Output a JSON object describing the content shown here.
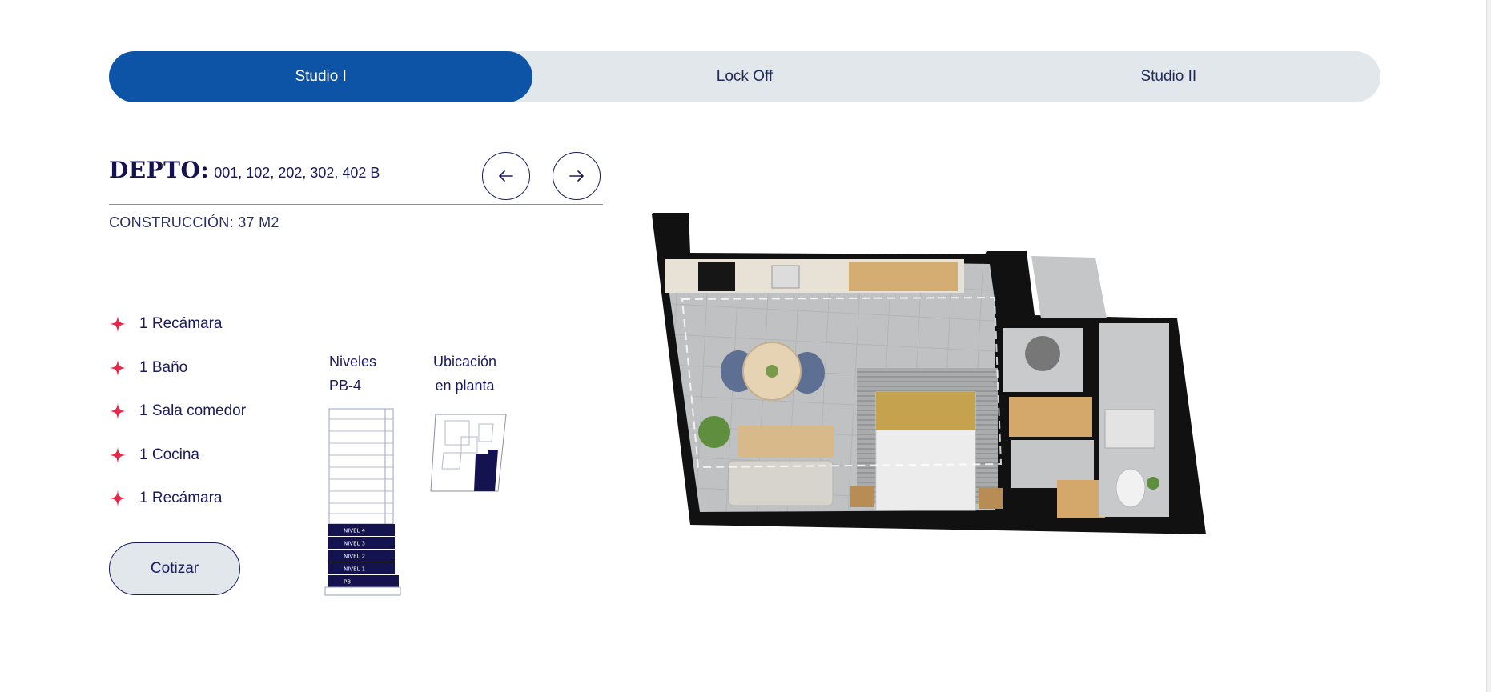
{
  "tabs": [
    {
      "label": "Studio I",
      "active": true
    },
    {
      "label": "Lock Off",
      "active": false
    },
    {
      "label": "Studio II",
      "active": false
    }
  ],
  "unit": {
    "depto_label": "DEPTO:",
    "depto_value": "001, 102, 202, 302, 402 B",
    "construccion": "CONSTRUCCIÓN: 37 M2"
  },
  "features": [
    "1 Recámara",
    "1 Baño",
    "1 Sala comedor",
    "1 Cocina",
    "1 Recámara"
  ],
  "levels": {
    "title_line1": "Niveles",
    "title_line2": "PB-4",
    "labels": [
      "NIVEL 4",
      "NIVEL 3",
      "NIVEL 2",
      "NIVEL 1",
      "PB"
    ]
  },
  "location": {
    "title_line1": "Ubicación",
    "title_line2": "en planta"
  },
  "cta": {
    "label": "Cotizar"
  },
  "icons": {
    "prev": "arrow-left-icon",
    "next": "arrow-right-icon",
    "bullet": "four-point-star-icon"
  },
  "colors": {
    "primary": "#0d54a6",
    "navy": "#14124f",
    "accent": "#e8264a",
    "tab_bg": "#e2e7ec"
  }
}
